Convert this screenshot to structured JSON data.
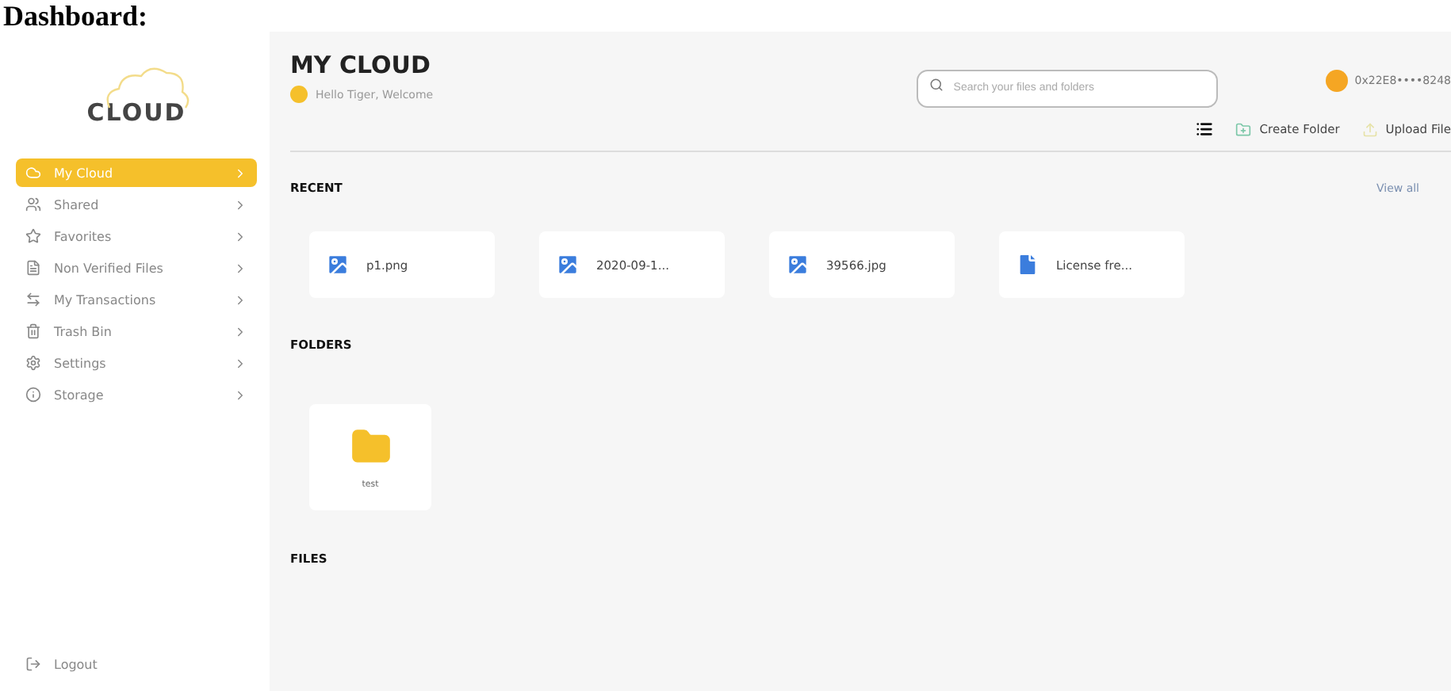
{
  "page_heading": "Dashboard:",
  "sidebar": {
    "logo": "CLOUD",
    "items": [
      {
        "label": "My Cloud",
        "selected": true
      },
      {
        "label": "Shared",
        "selected": false
      },
      {
        "label": "Favorites",
        "selected": false
      },
      {
        "label": "Non Verified Files",
        "selected": false
      },
      {
        "label": "My Transactions",
        "selected": false
      },
      {
        "label": "Trash Bin",
        "selected": false
      },
      {
        "label": "Settings",
        "selected": false
      },
      {
        "label": "Storage",
        "selected": false
      }
    ],
    "logout": "Logout"
  },
  "header": {
    "title": "MY CLOUD",
    "greeting": "Hello Tiger, Welcome",
    "search": {
      "placeholder": "Search your files and folders"
    },
    "wallet": "0x22E8••••8248"
  },
  "toolbar": {
    "create_folder": "Create Folder",
    "upload_file": "Upload File"
  },
  "recent": {
    "title": "RECENT",
    "view_all": "View all",
    "files": [
      {
        "name": "p1.png",
        "kind": "image"
      },
      {
        "name": "2020-09-1...",
        "kind": "image"
      },
      {
        "name": "39566.jpg",
        "kind": "image"
      },
      {
        "name": "License fre...",
        "kind": "document"
      }
    ]
  },
  "folders": {
    "title": "FOLDERS",
    "items": [
      {
        "name": "test"
      }
    ]
  },
  "files": {
    "title": "FILES"
  }
}
